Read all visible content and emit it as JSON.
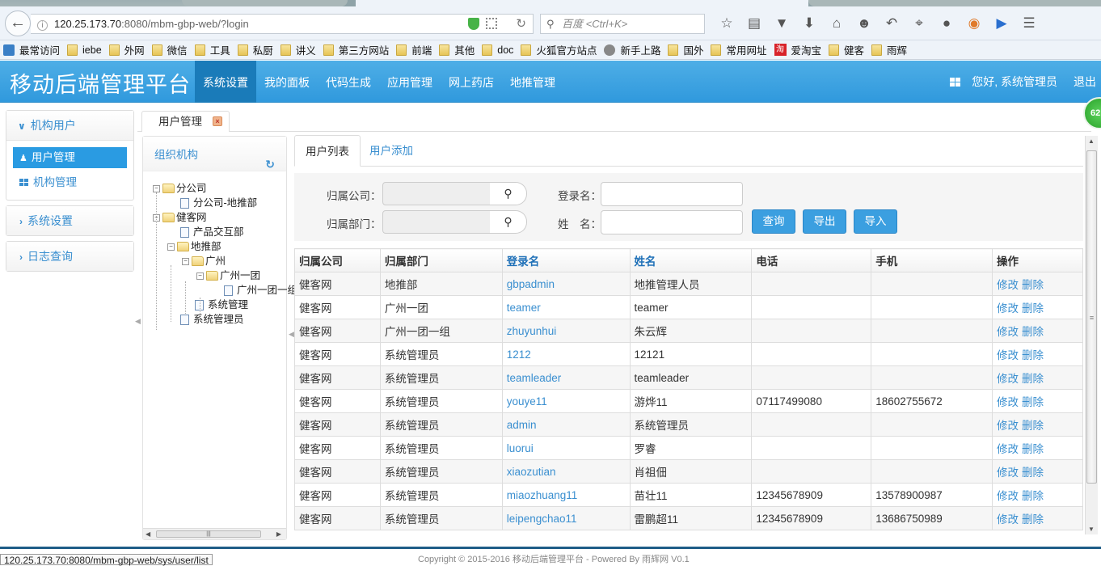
{
  "browser": {
    "url_host": "120.25.173.70",
    "url_path": ":8080/mbm-gbp-web/?login",
    "search_placeholder": "百度 <Ctrl+K>",
    "toolbar_icons": [
      "bookmark-star-icon",
      "reading-list-icon",
      "pocket-icon",
      "download-icon",
      "home-icon",
      "emoji-icon",
      "undo-icon",
      "dropdown-icon",
      "crop-icon",
      "dropdown-icon",
      "chat-icon",
      "extension-icon",
      "play-icon",
      "menu-icon"
    ],
    "bookmarks": [
      {
        "label": "最常访问",
        "icon": "most-visited-icon"
      },
      {
        "label": "iebe",
        "icon": "folder-icon"
      },
      {
        "label": "外网",
        "icon": "folder-icon"
      },
      {
        "label": "微信",
        "icon": "folder-icon"
      },
      {
        "label": "工具",
        "icon": "folder-icon"
      },
      {
        "label": "私厨",
        "icon": "folder-icon"
      },
      {
        "label": "讲义",
        "icon": "folder-icon"
      },
      {
        "label": "第三方网站",
        "icon": "folder-icon"
      },
      {
        "label": "前端",
        "icon": "folder-icon"
      },
      {
        "label": "其他",
        "icon": "folder-icon"
      },
      {
        "label": "doc",
        "icon": "folder-icon"
      },
      {
        "label": "火狐官方站点",
        "icon": "folder-icon"
      },
      {
        "label": "新手上路",
        "icon": "globe-icon"
      },
      {
        "label": "国外",
        "icon": "folder-icon"
      },
      {
        "label": "常用网址",
        "icon": "folder-icon"
      },
      {
        "label": "爱淘宝",
        "icon": "taobao-icon"
      },
      {
        "label": "健客",
        "icon": "folder-icon"
      },
      {
        "label": "雨辉",
        "icon": "folder-icon"
      }
    ],
    "status_url": "120.25.173.70:8080/mbm-gbp-web/sys/user/list",
    "badge": "62"
  },
  "header": {
    "brand": "移动后端管理平台",
    "nav": [
      "系统设置",
      "我的面板",
      "代码生成",
      "应用管理",
      "网上药店",
      "地推管理"
    ],
    "active_nav": 0,
    "greeting": "您好, 系统管理员",
    "logout": "退出"
  },
  "sidebar": {
    "groups": [
      {
        "label": "机构用户",
        "expanded": true,
        "items": [
          {
            "label": "用户管理",
            "icon": "user-icon",
            "active": true
          },
          {
            "label": "机构管理",
            "icon": "grid-icon",
            "active": false
          }
        ]
      },
      {
        "label": "系统设置",
        "expanded": false
      },
      {
        "label": "日志查询",
        "expanded": false
      }
    ]
  },
  "content_tab": {
    "label": "用户管理"
  },
  "org_tree": {
    "title": "组织机构",
    "nodes": [
      {
        "label": "分公司",
        "type": "folder",
        "level": 0
      },
      {
        "label": "分公司-地推部",
        "type": "file",
        "level": 1
      },
      {
        "label": "健客网",
        "type": "folder",
        "level": 0
      },
      {
        "label": "产品交互部",
        "type": "file",
        "level": 1
      },
      {
        "label": "地推部",
        "type": "folder",
        "level": 1
      },
      {
        "label": "广州",
        "type": "folder",
        "level": 2
      },
      {
        "label": "广州一团",
        "type": "folder",
        "level": 3
      },
      {
        "label": "广州一团一组",
        "type": "file",
        "level": 4
      },
      {
        "label": "系统管理",
        "type": "file",
        "level": 2
      },
      {
        "label": "系统管理员",
        "type": "file",
        "level": 1
      }
    ]
  },
  "subtabs": [
    "用户列表",
    "用户添加"
  ],
  "filter": {
    "company_label": "归属公司：",
    "company_value": "",
    "dept_label": "归属部门：",
    "dept_value": "",
    "login_label": "登录名：",
    "login_value": "",
    "name_label": "姓　名：",
    "name_value": "",
    "query": "查询",
    "export": "导出",
    "import": "导入"
  },
  "table": {
    "headers": [
      "归属公司",
      "归属部门",
      "登录名",
      "姓名",
      "电话",
      "手机",
      "操作"
    ],
    "edit": "修改",
    "delete": "删除",
    "rows": [
      [
        "健客网",
        "地推部",
        "gbpadmin",
        "地推管理人员",
        "",
        ""
      ],
      [
        "健客网",
        "广州一团",
        "teamer",
        "teamer",
        "",
        ""
      ],
      [
        "健客网",
        "广州一团一组",
        "zhuyunhui",
        "朱云辉",
        "",
        ""
      ],
      [
        "健客网",
        "系统管理员",
        "1212",
        "12121",
        "",
        ""
      ],
      [
        "健客网",
        "系统管理员",
        "teamleader",
        "teamleader",
        "",
        ""
      ],
      [
        "健客网",
        "系统管理员",
        "youye11",
        "游烨11",
        "07117499080",
        "18602755672"
      ],
      [
        "健客网",
        "系统管理员",
        "admin",
        "系统管理员",
        "",
        ""
      ],
      [
        "健客网",
        "系统管理员",
        "luorui",
        "罗睿",
        "",
        ""
      ],
      [
        "健客网",
        "系统管理员",
        "xiaozutian",
        "肖祖佃",
        "",
        ""
      ],
      [
        "健客网",
        "系统管理员",
        "miaozhuang11",
        "苗壮11",
        "12345678909",
        "13578900987"
      ],
      [
        "健客网",
        "系统管理员",
        "leipengchao11",
        "雷鹏超11",
        "12345678909",
        "13686750989"
      ]
    ]
  },
  "footer": {
    "copyright": "Copyright © 2015-2016 移动后端管理平台 - Powered By 雨辉网 V0.1"
  }
}
